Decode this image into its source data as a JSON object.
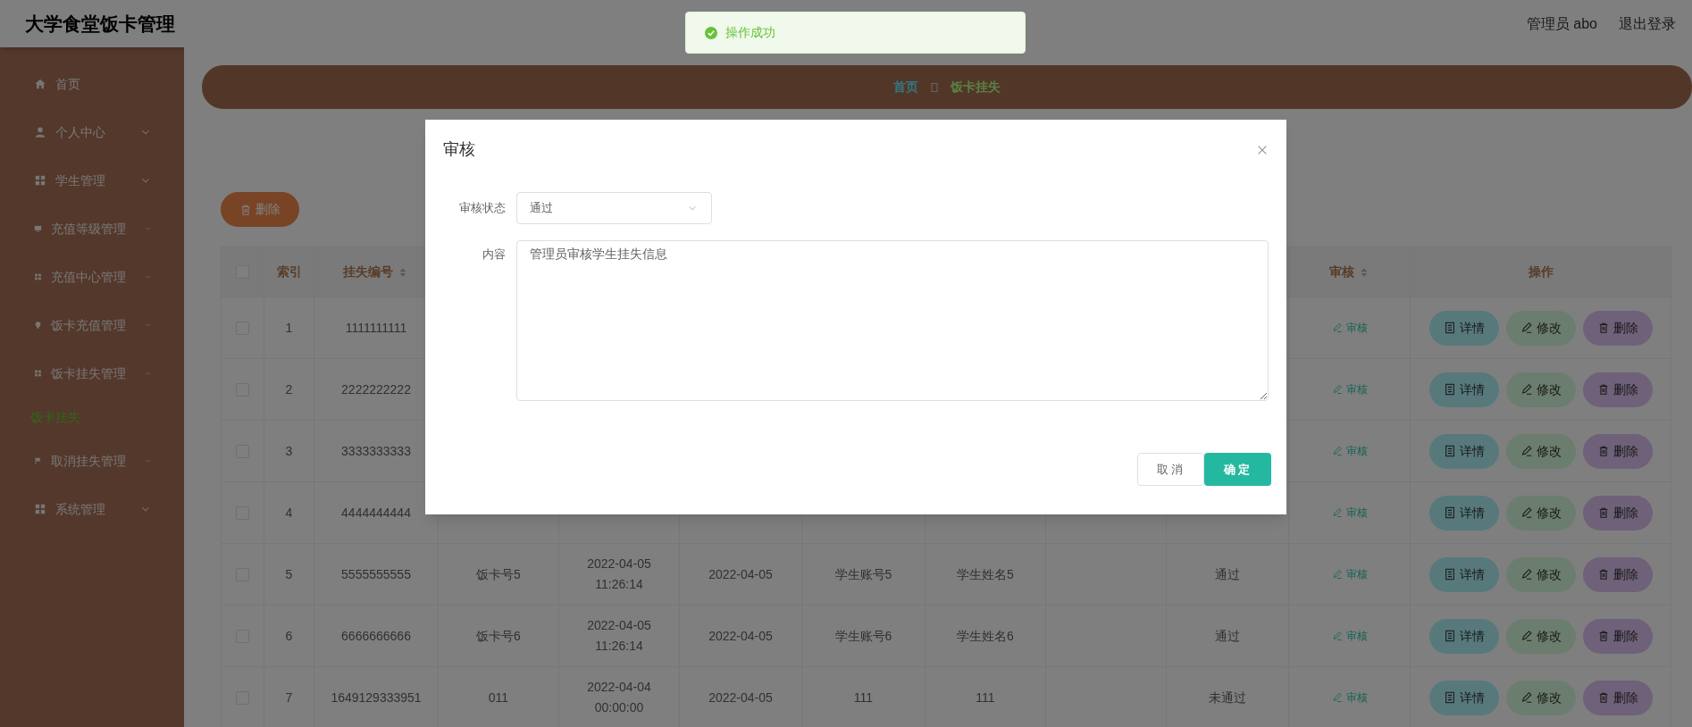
{
  "header": {
    "title": "大学食堂饭卡管理",
    "user": "管理员 abo",
    "logout": "退出登录"
  },
  "sidebar": {
    "items": [
      {
        "label": "首页",
        "kind": "link",
        "selected": false
      },
      {
        "label": "个人中心",
        "kind": "menu",
        "selected": false
      },
      {
        "label": "学生管理",
        "kind": "menu",
        "selected": false
      },
      {
        "label": "充值等级管理",
        "kind": "menu",
        "selected": false
      },
      {
        "label": "充值中心管理",
        "kind": "menu",
        "selected": false
      },
      {
        "label": "饭卡充值管理",
        "kind": "menu",
        "selected": false
      },
      {
        "label": "饭卡挂失管理",
        "kind": "menu",
        "selected": false,
        "children": [
          {
            "label": "饭卡挂失",
            "selected": true
          }
        ]
      },
      {
        "label": "取消挂失管理",
        "kind": "menu",
        "selected": false
      },
      {
        "label": "系统管理",
        "kind": "menu",
        "selected": false
      }
    ]
  },
  "breadcrumb": [
    {
      "label": "首页",
      "selected": false
    },
    {
      "label": "饭卡挂失",
      "selected": true
    }
  ],
  "toolbar": {
    "delete": "删除"
  },
  "table": {
    "select_all": {
      "checked": false
    },
    "columns": [
      {
        "label": "索引"
      },
      {
        "label": "挂失编号",
        "sortable": true
      },
      {},
      {},
      {},
      {},
      {},
      {},
      {},
      {
        "label": "审核",
        "sortable": true
      },
      {
        "label": "操作"
      }
    ],
    "rows": [
      {
        "checked": false,
        "cells": [
          "1",
          "1111111111"
        ],
        "review": "审核",
        "actions": [
          "详情",
          "修改",
          "删除"
        ]
      },
      {
        "checked": false,
        "cells": [
          "2",
          "2222222222"
        ],
        "review": "审核",
        "actions": [
          "详情",
          "修改",
          "删除"
        ]
      },
      {
        "checked": false,
        "cells": [
          "3",
          "3333333333"
        ],
        "review": "审核",
        "actions": [
          "详情",
          "修改",
          "删除"
        ]
      },
      {
        "checked": false,
        "cells": [
          "4",
          "4444444444",
          "",
          "",
          "",
          "",
          "",
          "",
          ""
        ],
        "review": "审核",
        "actions": [
          "详情",
          "修改",
          "删除"
        ]
      },
      {
        "checked": false,
        "cells": [
          "5",
          "5555555555",
          "饭卡号5",
          "2022-04-05 11:26:14",
          "2022-04-05",
          "学生账号5",
          "学生姓名5",
          "",
          "通过"
        ],
        "review": "审核",
        "actions": [
          "详情",
          "修改",
          "删除"
        ]
      },
      {
        "checked": false,
        "cells": [
          "6",
          "6666666666",
          "饭卡号6",
          "2022-04-05 11:26:14",
          "2022-04-05",
          "学生账号6",
          "学生姓名6",
          "",
          "通过"
        ],
        "review": "审核",
        "actions": [
          "详情",
          "修改",
          "删除"
        ]
      },
      {
        "checked": false,
        "cells": [
          "7",
          "1649129333951",
          "011",
          "2022-04-04 00:00:00",
          "2022-04-05",
          "111",
          "111",
          "",
          "未通过"
        ],
        "review": "审核",
        "actions": [
          "详情",
          "修改",
          "删除"
        ]
      }
    ]
  },
  "toast": {
    "message": "操作成功"
  },
  "dialog": {
    "title": "审核",
    "fields": [
      {
        "label": "审核状态",
        "kind": "select",
        "value": "通过"
      },
      {
        "label": "内容",
        "kind": "textarea",
        "value": "管理员审核学生挂失信息"
      }
    ],
    "buttons": [
      {
        "label": "取消",
        "primary": false
      },
      {
        "label": "确定",
        "primary": true
      }
    ]
  }
}
